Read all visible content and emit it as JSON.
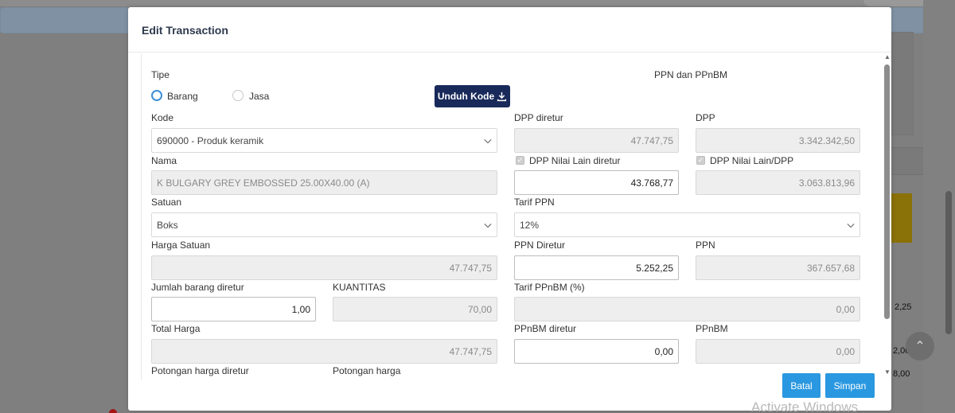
{
  "modal": {
    "title": "Edit Transaction",
    "cancel_label": "Batal",
    "save_label": "Simpan"
  },
  "form": {
    "tipe_label": "Tipe",
    "tipe_options": [
      "Barang",
      "Jasa"
    ],
    "tipe_selected": "Barang",
    "unduh_label": "Unduh Kode",
    "kode_label": "Kode",
    "kode_value": "690000 - Produk keramik",
    "nama_label": "Nama",
    "nama_value": "K BULGARY GREY EMBOSSED 25.00X40.00 (A)",
    "satuan_label": "Satuan",
    "satuan_value": "Boks",
    "harga_satuan_label": "Harga Satuan",
    "harga_satuan_value": "47.747,75",
    "jumlah_diretur_label": "Jumlah barang diretur",
    "jumlah_diretur_value": "1,00",
    "kuantitas_label": "KUANTITAS",
    "kuantitas_value": "70,00",
    "total_harga_label": "Total Harga",
    "total_harga_value": "47.747,75",
    "potongan_diretur_label": "Potongan harga diretur",
    "potongan_label": "Potongan harga"
  },
  "ppn": {
    "section_title": "PPN dan PPnBM",
    "dpp_diretur_label": "DPP diretur",
    "dpp_diretur_value": "47.747,75",
    "dpp_label": "DPP",
    "dpp_value": "3.342.342,50",
    "dpp_nilai_lain_diretur_label": "DPP Nilai Lain diretur",
    "dpp_nilai_lain_diretur_value": "43.768,77",
    "dpp_nilai_lain_label": "DPP Nilai Lain/DPP",
    "dpp_nilai_lain_value": "3.063.813,96",
    "tarif_ppn_label": "Tarif PPN",
    "tarif_ppn_value": "12%",
    "ppn_diretur_label": "PPN Diretur",
    "ppn_diretur_value": "5.252,25",
    "ppn_label": "PPN",
    "ppn_value": "367.657,68",
    "tarif_ppnbm_label": "Tarif PPnBM (%)",
    "tarif_ppnbm_value": "0,00",
    "ppnbm_diretur_label": "PPnBM diretur",
    "ppnbm_diretur_value": "0,00",
    "ppnbm_label": "PPnBM",
    "ppnbm_value": "0,00"
  },
  "background": {
    "side_values": [
      "2,25",
      "2,00",
      "8,00"
    ],
    "watermark": "Activate Windows"
  },
  "colors": {
    "primary_dark": "#18295a",
    "accent_blue": "#2a98e0",
    "radio_blue": "#3f8fd8",
    "readonly_bg": "#eeeeee"
  }
}
